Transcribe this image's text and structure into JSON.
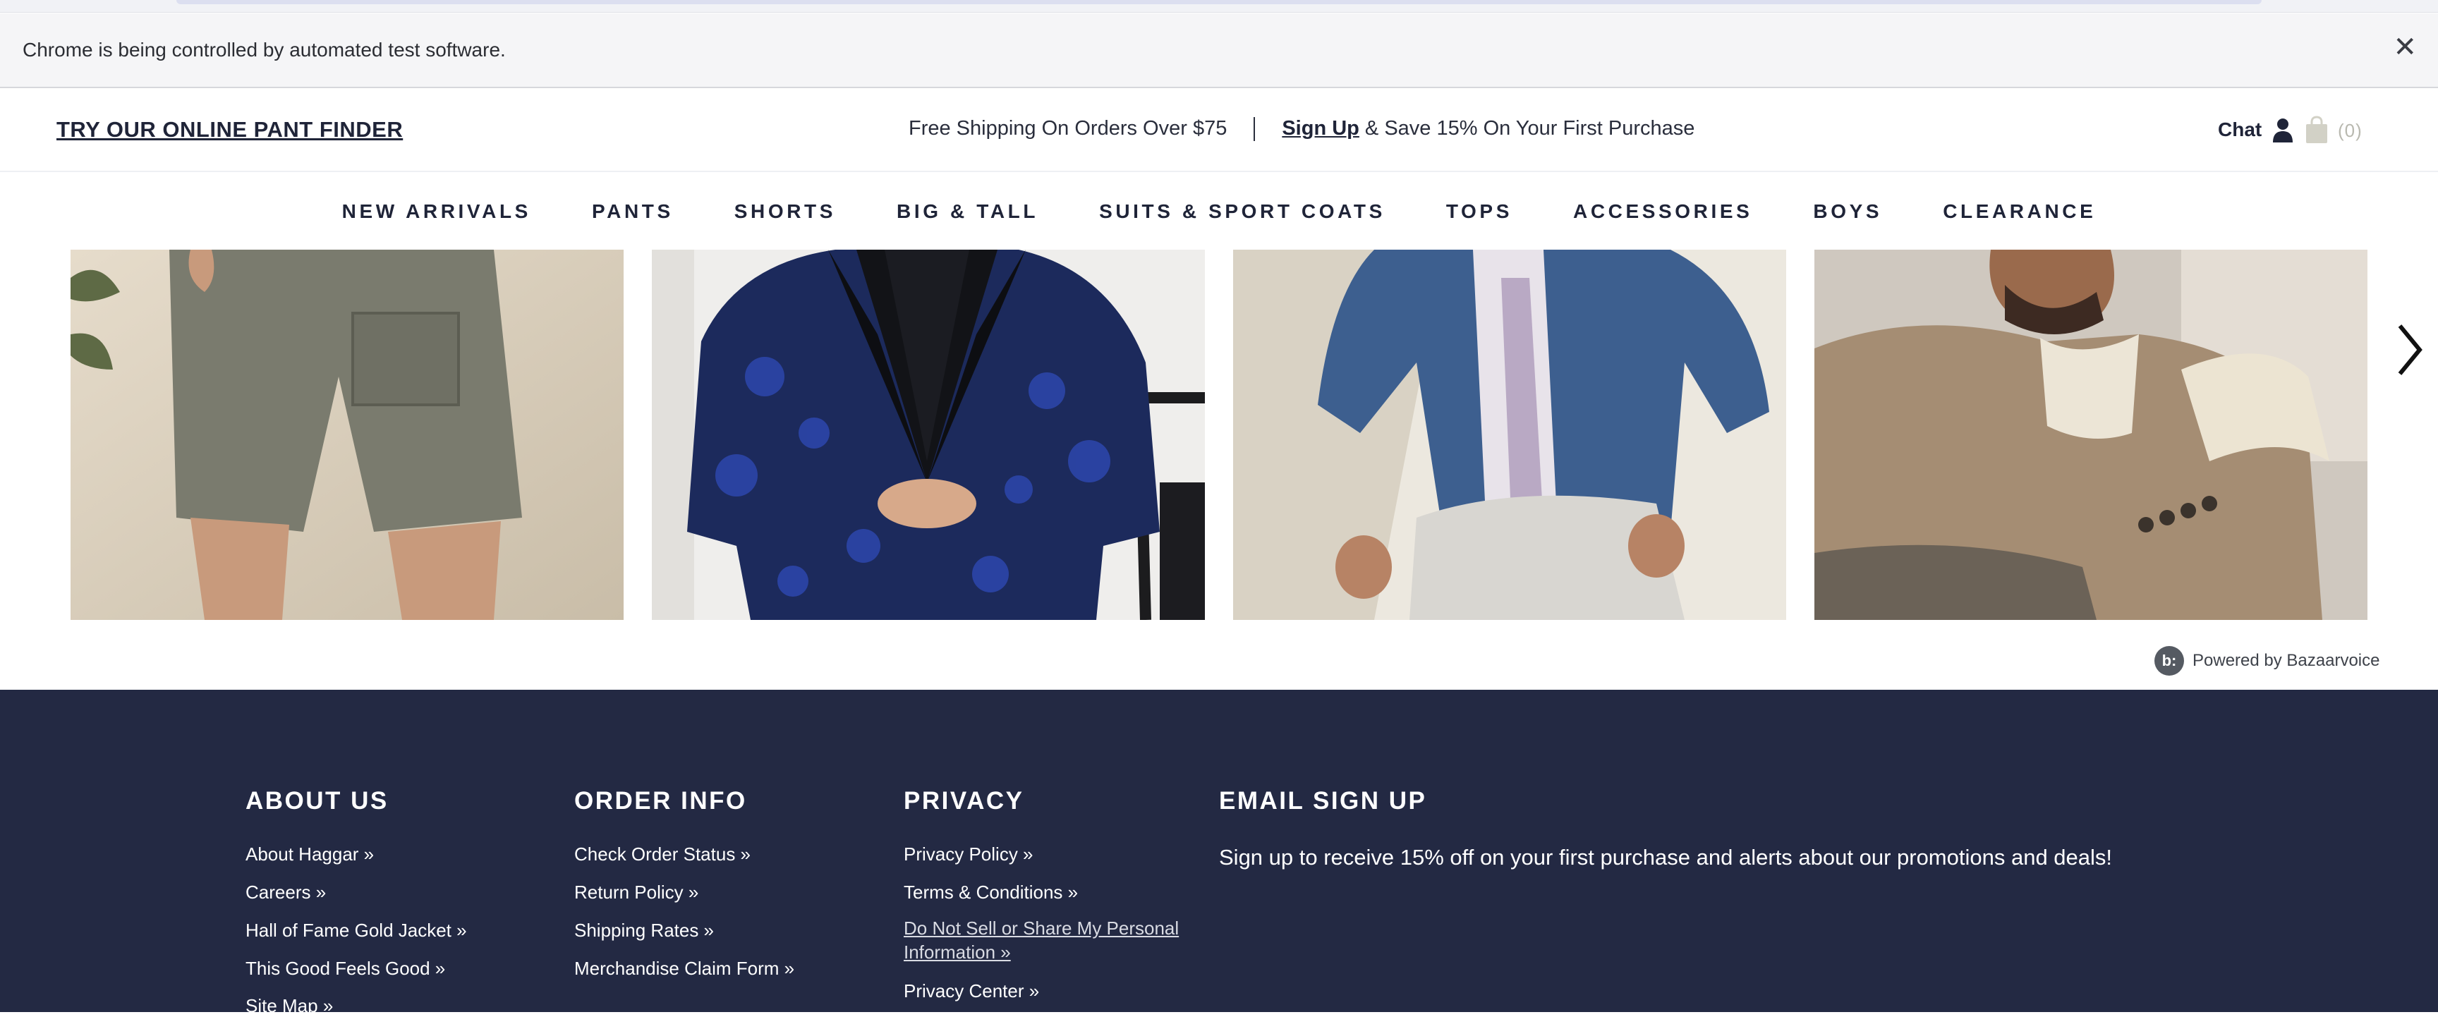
{
  "browser": {
    "infobar_message": "Chrome is being controlled by automated test software.",
    "close_glyph": "✕"
  },
  "promo": {
    "pant_finder": "TRY OUR ONLINE PANT FINDER",
    "shipping": "Free Shipping On Orders Over $75",
    "signup_link": "Sign Up",
    "signup_rest": " & Save 15% On Your First Purchase",
    "chat": "Chat",
    "cart_count": "(0)",
    "icons": [
      "user-icon",
      "shopping-bag-icon"
    ]
  },
  "nav": {
    "items": [
      "NEW ARRIVALS",
      "PANTS",
      "SHORTS",
      "BIG & TALL",
      "SUITS & SPORT COATS",
      "TOPS",
      "ACCESSORIES",
      "BOYS",
      "CLEARANCE"
    ]
  },
  "gallery": {
    "tiles": [
      "cargo-shorts-photo",
      "blue-paisley-tuxedo-jacket-photo",
      "denim-jacket-photo",
      "tan-blazer-photo"
    ],
    "next_icon": "chevron-right-icon",
    "powered_by": "Powered by Bazaarvoice",
    "bv_logo": "b:"
  },
  "footer": {
    "about": {
      "heading": "ABOUT US",
      "links": [
        "About Haggar »",
        "Careers »",
        "Hall of Fame Gold Jacket »",
        "This Good Feels Good »",
        "Site Map »"
      ]
    },
    "order": {
      "heading": "ORDER INFO",
      "links": [
        "Check Order Status »",
        "Return Policy »",
        "Shipping Rates »",
        "Merchandise Claim Form »"
      ]
    },
    "privacy": {
      "heading": "PRIVACY",
      "links": [
        "Privacy Policy »",
        "Terms & Conditions »",
        "Do Not Sell or Share My Personal Information »",
        "Privacy Center »"
      ]
    },
    "email": {
      "heading": "EMAIL SIGN UP",
      "description": "Sign up to receive 15% off on your first purchase and alerts about our promotions and deals!"
    }
  },
  "colors": {
    "footer_bg": "#232943",
    "text_dark": "#1f2438"
  }
}
